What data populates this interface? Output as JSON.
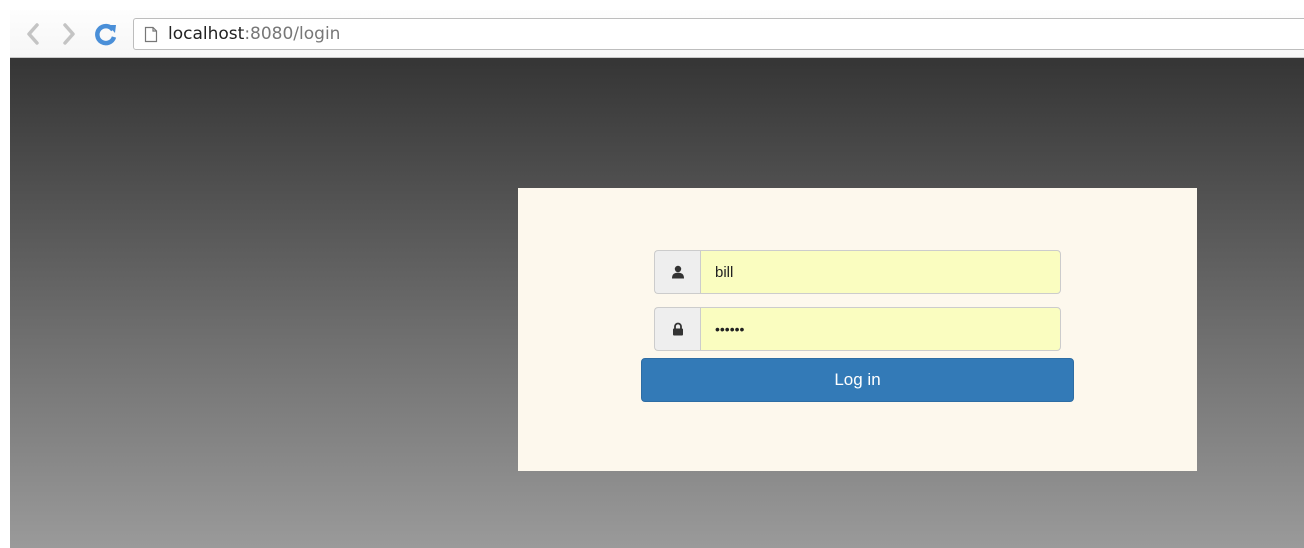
{
  "browser": {
    "url_host": "localhost",
    "url_rest": ":8080/login",
    "icons": {
      "back": "back-arrow-icon",
      "forward": "forward-arrow-icon",
      "reload": "reload-icon",
      "page": "page-icon"
    }
  },
  "login_form": {
    "username": {
      "icon": "user-icon",
      "value": "bill"
    },
    "password": {
      "icon": "lock-icon",
      "value": "••••••"
    },
    "submit_label": "Log in"
  },
  "colors": {
    "card_background": "#fdf8ed",
    "autofill_field": "#fafdc0",
    "button_primary": "#337ab7",
    "reload_icon": "#4a8fd8"
  }
}
